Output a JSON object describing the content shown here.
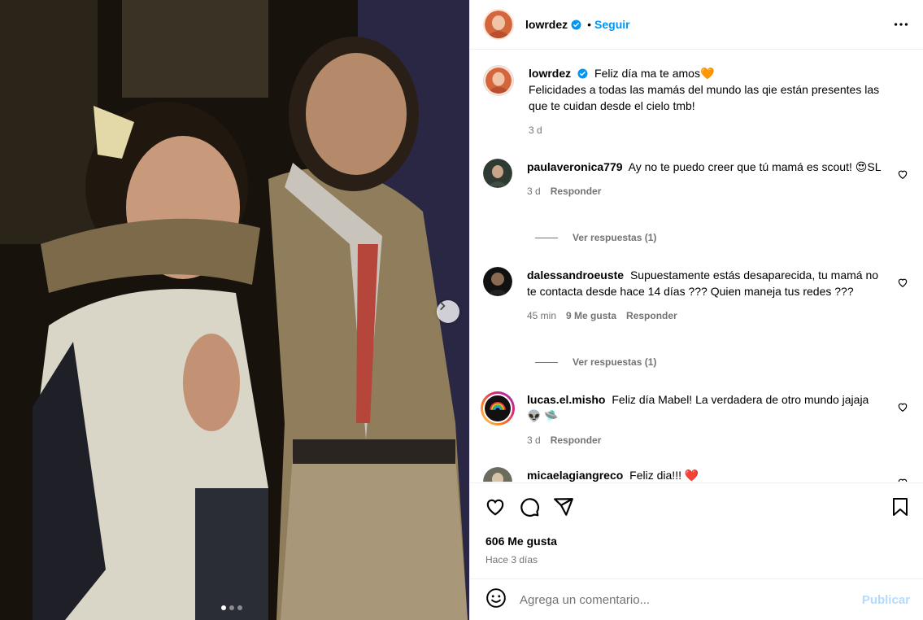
{
  "post": {
    "author": "lowrdez",
    "follow_label": "Seguir",
    "separator": "•",
    "caption_line1": "Feliz día ma te amos",
    "caption_emoji": "🧡",
    "caption_rest": "Felicidades a todas las mamás del mundo las qie están presentes las que te cuidan desde el cielo tmb!",
    "caption_time": "3 d"
  },
  "comments": [
    {
      "user": "paulaveronica779",
      "text": "Ay no te puedo creer que tú mamá es scout!",
      "text_emoji": "😍SL",
      "time": "3 d",
      "likes": "",
      "reply_label": "Responder",
      "view_replies": "Ver respuestas (1)"
    },
    {
      "user": "dalessandroeuste",
      "text": "Supuestamente estás desaparecida, tu mamá no te contacta desde hace 14 días ??? Quien maneja tus redes ???",
      "time": "45 min",
      "likes": "9 Me gusta",
      "reply_label": "Responder",
      "view_replies": "Ver respuestas (1)"
    },
    {
      "user": "lucas.el.misho",
      "text": "Feliz día Mabel! La verdadera de otro mundo jajaja 👽 🛸",
      "time": "3 d",
      "reply_label": "Responder"
    },
    {
      "user": "micaelagiangreco",
      "text": "Feliz dia!!! ❤️"
    }
  ],
  "footer": {
    "likes": "606 Me gusta",
    "posted_ago": "Hace 3 días",
    "comment_placeholder": "Agrega un comentario...",
    "publish_label": "Publicar"
  },
  "carousel": {
    "slides": 3,
    "active": 1
  },
  "colors": {
    "link": "#0095f6",
    "publish_disabled": "#b3dbff",
    "muted": "#737373",
    "divider": "#efefef"
  },
  "icons": [
    "heart-icon",
    "comment-icon",
    "share-icon",
    "bookmark-icon",
    "emoji-icon",
    "more-icon",
    "verified-icon",
    "chevron-right-icon"
  ]
}
